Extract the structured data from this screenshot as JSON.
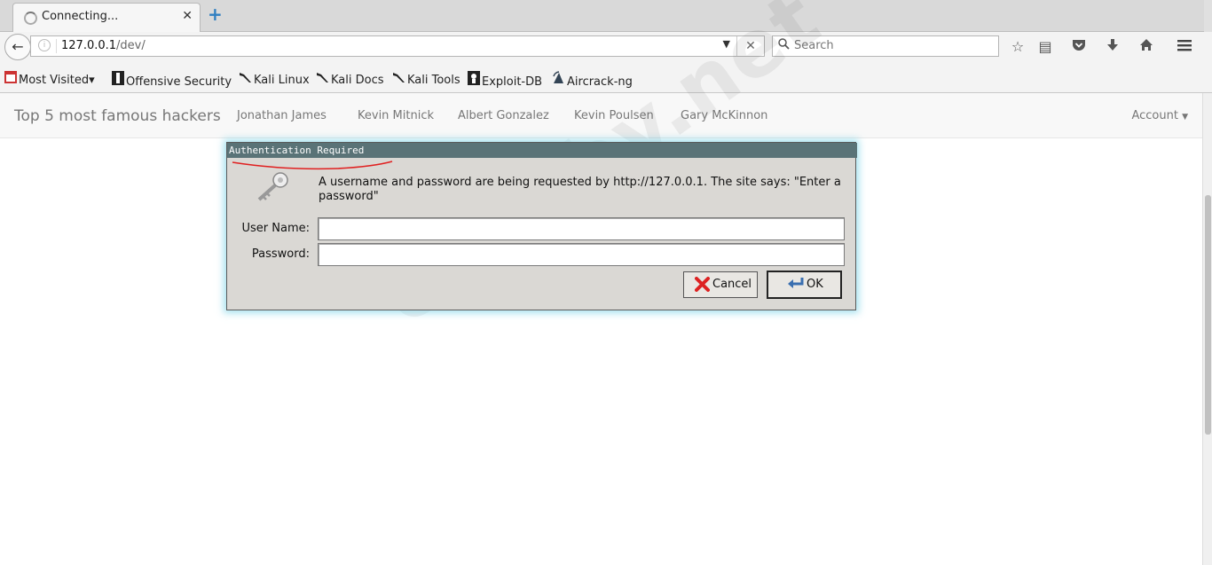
{
  "browser": {
    "tab_title": "Connecting...",
    "url_host": "127.0.0.1",
    "url_path": "/dev/",
    "search_placeholder": "Search"
  },
  "bookmarks": [
    {
      "label": "Most Visited",
      "icon": "most-visited-icon"
    },
    {
      "label": "Offensive Security",
      "icon": "offsec-icon"
    },
    {
      "label": "Kali Linux",
      "icon": "kali-dragon-icon"
    },
    {
      "label": "Kali Docs",
      "icon": "kali-dragon-icon"
    },
    {
      "label": "Kali Tools",
      "icon": "kali-dragon-icon"
    },
    {
      "label": "Exploit-DB",
      "icon": "exploitdb-icon"
    },
    {
      "label": "Aircrack-ng",
      "icon": "aircrack-icon"
    }
  ],
  "page": {
    "brand": "Top 5 most famous hackers",
    "links": [
      "Jonathan James",
      "Kevin Mitnick",
      "Albert Gonzalez",
      "Kevin Poulsen",
      "Gary McKinnon"
    ],
    "account": "Account"
  },
  "dialog": {
    "title": "Authentication Required",
    "message": "A username and password are being requested by http://127.0.0.1. The site says: \"Enter a password\"",
    "username_label": "User Name:",
    "password_label": "Password:",
    "username_value": "",
    "password_value": "",
    "cancel_label": "Cancel",
    "ok_label": "OK"
  },
  "watermark": "codeby.net",
  "colors": {
    "dialog_title_bg": "#5a7377",
    "dialog_glow": "#78d2e6",
    "annotation_red": "#e02020"
  }
}
